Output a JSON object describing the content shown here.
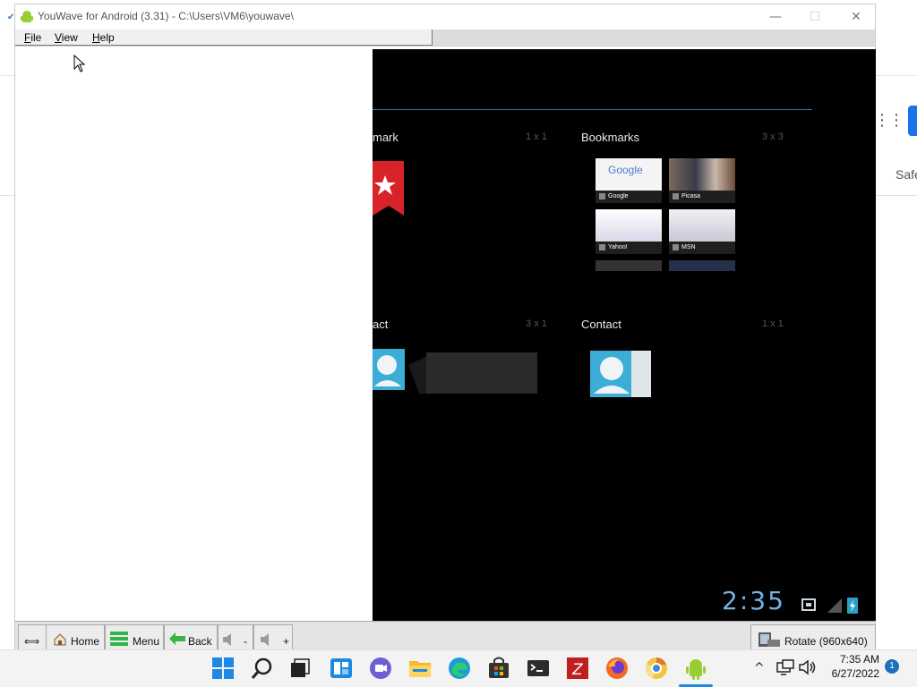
{
  "background_app": {
    "partial_text": "Safe"
  },
  "window": {
    "title": "YouWave for Android (3.31) - C:\\Users\\VM6\\youwave\\",
    "controls": {
      "minimize": "—",
      "maximize": "☐",
      "close": "✕"
    }
  },
  "menu": {
    "items": [
      {
        "ul": "F",
        "rest": "ile"
      },
      {
        "ul": "V",
        "rest": "iew"
      },
      {
        "ul": "H",
        "rest": "elp"
      }
    ]
  },
  "android": {
    "widgets": [
      {
        "label": "mark",
        "size": "1 x 1"
      },
      {
        "label": "Bookmarks",
        "size": "3 x 3"
      },
      {
        "label": "act",
        "size": "3 x 1"
      },
      {
        "label": "Contact",
        "size": "1 x 1"
      }
    ],
    "thumbnails": [
      {
        "caption": "Google"
      },
      {
        "caption": "Picasa"
      },
      {
        "caption": "Yahoo!"
      },
      {
        "caption": "MSN"
      }
    ],
    "google_logo": "Google",
    "clock": "2:35"
  },
  "toolbar": {
    "home": "Home",
    "menu": "Menu",
    "back": "Back",
    "vol_down": "-",
    "vol_up": "+",
    "rotate": "Rotate (960x640)"
  },
  "taskbar": {
    "time": "7:35 AM",
    "date": "6/27/2022",
    "notification_count": "1",
    "icons": [
      "start",
      "search",
      "task-view",
      "widgets",
      "chat",
      "file-explorer",
      "edge",
      "store",
      "terminal",
      "filezilla",
      "firefox",
      "chrome-canary",
      "youwave"
    ]
  }
}
